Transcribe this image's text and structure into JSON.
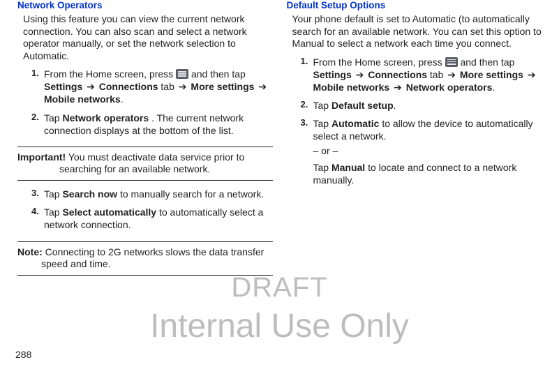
{
  "page_number": "288",
  "watermark": {
    "line1": "DRAFT",
    "line2": "Internal Use Only"
  },
  "left": {
    "title": "Network Operators",
    "intro": "Using this feature you can view the current network connection. You can also scan and select a network operator manually, or set the network selection to Automatic.",
    "step1_a": "From the Home screen, press ",
    "step1_b": " and then tap ",
    "step1_settings": "Settings",
    "step1_connections": "Connections",
    "step1_tab": " tab ",
    "step1_more": "More settings",
    "step1_mobile": "Mobile networks",
    "step2_a": "Tap ",
    "step2_b": "Network operators",
    "step2_c": ". The current network connection displays at the bottom of the list.",
    "important_label": "Important!",
    "important_body": " You must deactivate data service prior to searching for an available network.",
    "step3_a": "Tap ",
    "step3_b": "Search now",
    "step3_c": " to manually search for a network.",
    "step4_a": "Tap ",
    "step4_b": "Select automatically",
    "step4_c": " to automatically select a network connection.",
    "note_label": "Note:",
    "note_body": " Connecting to 2G networks slows the data transfer speed and time."
  },
  "right": {
    "title": "Default Setup Options",
    "intro": "Your phone default is set to Automatic (to automatically search for an available network. You can set this option to Manual to select a network each time you connect.",
    "step1_a": "From the Home screen, press ",
    "step1_b": " and then tap ",
    "step1_settings": "Settings",
    "step1_connections": "Connections",
    "step1_tab": " tab ",
    "step1_more": "More settings",
    "step1_mobile": "Mobile networks",
    "step1_netop": "Network operators",
    "step2_a": "Tap ",
    "step2_b": "Default setup",
    "step3_a": "Tap ",
    "step3_b": "Automatic",
    "step3_c": " to allow the device to automatically select a network.",
    "or": "– or –",
    "step3_d": "Tap ",
    "step3_e": "Manual",
    "step3_f": " to locate and connect to a network manually."
  },
  "arrow": "➔",
  "period": "."
}
